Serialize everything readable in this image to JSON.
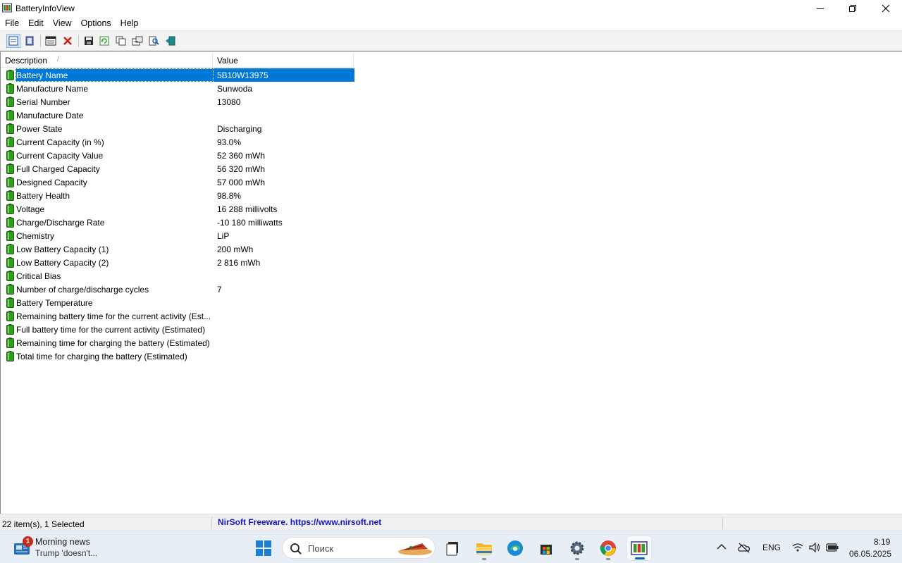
{
  "window": {
    "title": "BatteryInfoView"
  },
  "menu": [
    "File",
    "Edit",
    "View",
    "Options",
    "Help"
  ],
  "columns": {
    "description": "Description",
    "value": "Value"
  },
  "rows": [
    {
      "description": "Battery Name",
      "value": "5B10W13975"
    },
    {
      "description": "Manufacture Name",
      "value": "Sunwoda"
    },
    {
      "description": "Serial Number",
      "value": "13080"
    },
    {
      "description": "Manufacture Date",
      "value": ""
    },
    {
      "description": "Power State",
      "value": "Discharging"
    },
    {
      "description": "Current Capacity (in %)",
      "value": "93.0%"
    },
    {
      "description": "Current Capacity Value",
      "value": "52 360 mWh"
    },
    {
      "description": "Full Charged Capacity",
      "value": "56 320 mWh"
    },
    {
      "description": "Designed Capacity",
      "value": "57 000 mWh"
    },
    {
      "description": "Battery Health",
      "value": "98.8%"
    },
    {
      "description": "Voltage",
      "value": "16 288 millivolts"
    },
    {
      "description": "Charge/Discharge Rate",
      "value": "-10 180 milliwatts"
    },
    {
      "description": "Chemistry",
      "value": "LiP"
    },
    {
      "description": "Low Battery Capacity (1)",
      "value": "200 mWh"
    },
    {
      "description": "Low Battery Capacity (2)",
      "value": "2 816 mWh"
    },
    {
      "description": "Critical Bias",
      "value": ""
    },
    {
      "description": "Number of charge/discharge cycles",
      "value": "7"
    },
    {
      "description": "Battery Temperature",
      "value": ""
    },
    {
      "description": "Remaining battery time for the current activity (Est...",
      "value": ""
    },
    {
      "description": "Full battery time for the current activity (Estimated)",
      "value": ""
    },
    {
      "description": "Remaining time for charging the battery (Estimated)",
      "value": ""
    },
    {
      "description": "Total  time for charging the battery (Estimated)",
      "value": ""
    }
  ],
  "selected_row": 0,
  "status": {
    "items": "22 item(s), 1 Selected",
    "link": "NirSoft Freeware. https://www.nirsoft.net"
  },
  "taskbar": {
    "news_title": "Morning news",
    "news_sub": "Trump 'doesn't...",
    "news_badge": "1",
    "search_placeholder": "Поиск",
    "lang": "ENG",
    "time": "8:19",
    "date": "06.05.2025"
  },
  "colors": {
    "selection": "#0078d7",
    "battery_icon": "#2f9e1f",
    "link": "#1515c8",
    "taskbar": "#e8eef6"
  }
}
